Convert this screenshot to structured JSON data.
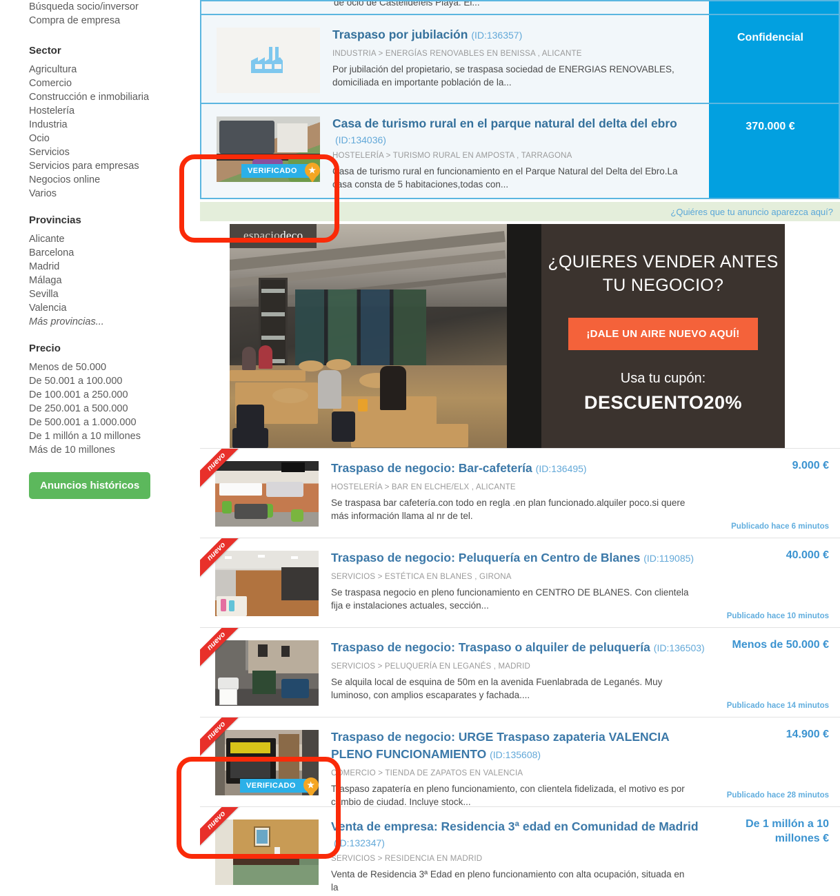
{
  "sidebar": {
    "top_links": [
      "Búsqueda socio/inversor",
      "Compra de empresa"
    ],
    "sections": [
      {
        "heading": "Sector",
        "items": [
          "Agricultura",
          "Comercio",
          "Construcción e inmobiliaria",
          "Hostelería",
          "Industria",
          "Ocio",
          "Servicios",
          "Servicios para empresas",
          "Negocios online",
          "Varios"
        ]
      },
      {
        "heading": "Provincias",
        "items": [
          "Alicante",
          "Barcelona",
          "Madrid",
          "Málaga",
          "Sevilla",
          "Valencia",
          "Más provincias..."
        ]
      },
      {
        "heading": "Precio",
        "items": [
          "Menos de 50.000",
          "De 50.001 a 100.000",
          "De 100.001 a 250.000",
          "De 250.001 a 500.000",
          "De 500.001 a 1.000.000",
          "De 1 millón a 10 millones",
          "Más de 10 millones"
        ]
      }
    ],
    "historic_button": "Anuncios históricos"
  },
  "partial_top": {
    "desc_tail": "de ocio de Castelldefels Playa. El..."
  },
  "featured_listings": [
    {
      "title": "Traspaso por jubilación",
      "id": "(ID:136357)",
      "category": "INDUSTRIA > ENERGÍAS RENOVABLES EN BENISSA , ALICANTE",
      "desc": "Por jubilación del propietario, se traspasa sociedad de ENERGIAS RENOVABLES, domiciliada en importante población de la...",
      "price": "Confidencial",
      "thumb_kind": "factory-icon",
      "verified": false
    },
    {
      "title": "Casa de turismo rural en el parque natural del delta del ebro",
      "id": "(ID:134036)",
      "category": "HOSTELERÍA > TURISMO RURAL EN AMPOSTA , TARRAGONA",
      "desc": "Casa de turismo rural en funcionamiento en el Parque Natural del Delta del Ebro.La casa consta de 5 habitaciones,todas con...",
      "price": "370.000 €",
      "thumb_kind": "photo-terrace",
      "verified": true,
      "verified_label": "VERIFICADO"
    }
  ],
  "promo_bar": {
    "link": "¿Quiéres que tu anuncio aparezca aquí?"
  },
  "banner": {
    "logo_light": "espacio",
    "logo_bold": "deco",
    "headline_line1": "¿QUIERES VENDER ANTES",
    "headline_line2": "TU NEGOCIO?",
    "cta": "¡DALE UN AIRE NUEVO AQUÍ!",
    "coupon_label": "Usa tu cupón:",
    "coupon_code": "DESCUENTO20%"
  },
  "listings": [
    {
      "ribbon": "nuevo",
      "title": "Traspaso de negocio: Bar-cafetería",
      "id": "(ID:136495)",
      "category": "HOSTELERÍA > BAR EN ELCHE/ELX , ALICANTE",
      "desc": "Se traspasa bar cafetería.con todo en regla .en plan funcionado.alquiler poco.si quere más información llama al nr de tel.",
      "price": "9.000 €",
      "published": "Publicado hace 6 minutos",
      "thumb_kind": "photo-bar",
      "verified": false
    },
    {
      "ribbon": "nuevo",
      "title": "Traspaso de negocio: Peluquería en Centro de Blanes",
      "id": "(ID:119085)",
      "category": "SERVICIOS > ESTÉTICA EN BLANES , GIRONA",
      "desc": "Se traspasa negocio en pleno funcionamiento en CENTRO DE BLANES. Con clientela fija e instalaciones actuales, sección...",
      "price": "40.000 €",
      "published": "Publicado hace 10 minutos",
      "thumb_kind": "photo-salon",
      "verified": false
    },
    {
      "ribbon": "nuevo",
      "title": "Traspaso de negocio: Traspaso o alquiler de peluquería",
      "id": "(ID:136503)",
      "category": "SERVICIOS > PELUQUERÍA EN LEGANÉS , MADRID",
      "desc": "Se alquila local de esquina de 50m en la avenida Fuenlabrada de Leganés. Muy luminoso, con amplios escaparates y fachada....",
      "price": "Menos de 50.000  €",
      "published": "Publicado hace 14 minutos",
      "thumb_kind": "photo-street",
      "verified": false
    },
    {
      "ribbon": "nuevo",
      "title": "Traspaso de negocio: URGE Traspaso zapateria VALENCIA PLENO FUNCIONAMIENTO",
      "id": "(ID:135608)",
      "category": "COMERCIO > TIENDA DE ZAPATOS EN VALENCIA",
      "desc": "Traspaso zapatería en pleno funcionamiento, con clientela fidelizada, el motivo es por cambio de ciudad. Incluye stock...",
      "price": "14.900 €",
      "published": "Publicado hace 28 minutos",
      "thumb_kind": "photo-shop",
      "verified": true,
      "verified_label": "VERIFICADO"
    },
    {
      "ribbon": "nuevo",
      "title": "Venta de empresa: Residencia 3ª edad en Comunidad de Madrid",
      "id": "(ID:132347)",
      "category": "SERVICIOS > RESIDENCIA EN MADRID",
      "desc": "Venta de Residencia 3ª Edad en pleno funcionamiento con alta ocupación, situada en la",
      "price": "De 1 millón a 10 millones  €",
      "published": "",
      "thumb_kind": "photo-room",
      "verified": false
    }
  ],
  "colors": {
    "accent_blue": "#02a0e0",
    "link_blue": "#3b93d0",
    "ribbon_red": "#e8302a",
    "green_button": "#5cb85c",
    "promo_green": "#e4eedb",
    "cta_orange": "#f4623a",
    "annotation_red": "#fa2a08"
  }
}
